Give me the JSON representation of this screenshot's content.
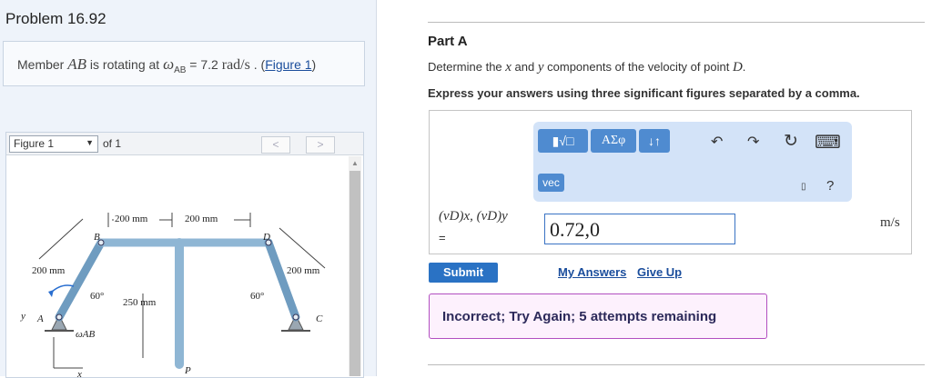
{
  "problem": {
    "title": "Problem 16.92",
    "statement_prefix": "Member ",
    "member": "AB",
    "statement_mid": " is rotating at ",
    "omega_symbol": "ω",
    "omega_sub": "AB",
    "statement_value": " = 7.2 ",
    "units": "rad/s",
    "statement_after": " . (",
    "figure_link": "Figure 1",
    "statement_end": ")"
  },
  "figure": {
    "selector_value": "Figure 1",
    "of_label": "of 1",
    "prev": "<",
    "next": ">",
    "labels": {
      "B": "B",
      "D": "D",
      "A": "A",
      "C": "C",
      "P": "P",
      "x": "x",
      "y": "y",
      "dim_200_1": "200 mm",
      "dim_200_2": "200 mm",
      "dim_200_left": "200 mm",
      "dim_200_right": "200 mm",
      "dim_250": "250 mm",
      "angle_left": "60°",
      "angle_right": "60°",
      "omega": "ωAB"
    }
  },
  "part": {
    "title": "Part A",
    "question_prefix": "Determine the ",
    "x_var": "x",
    "question_and": " and ",
    "y_var": "y",
    "question_suffix": " components of the velocity of point ",
    "point": "D",
    "question_end": ".",
    "instruction": "Express your answers using three significant figures separated by a comma."
  },
  "toolbar": {
    "templates_icon": "▮√□",
    "greek": "ΑΣφ",
    "sort_icon": "↓↑",
    "undo": "↶",
    "redo": "↷",
    "reset": "↻",
    "keyboard": "⌨",
    "vec": "vec",
    "help": "?",
    "mini": "▯"
  },
  "answer": {
    "label": "(vD)x, (vD)y",
    "equals": "=",
    "value": "0.72,0",
    "unit": "m/s"
  },
  "actions": {
    "submit": "Submit",
    "my_answers": "My Answers",
    "give_up": "Give Up"
  },
  "feedback": {
    "message": "Incorrect; Try Again; 5 attempts remaining"
  },
  "colors": {
    "accent": "#2a72c4",
    "feedback_border": "#b24fc0",
    "toolbar_bg": "#d3e3f8"
  }
}
